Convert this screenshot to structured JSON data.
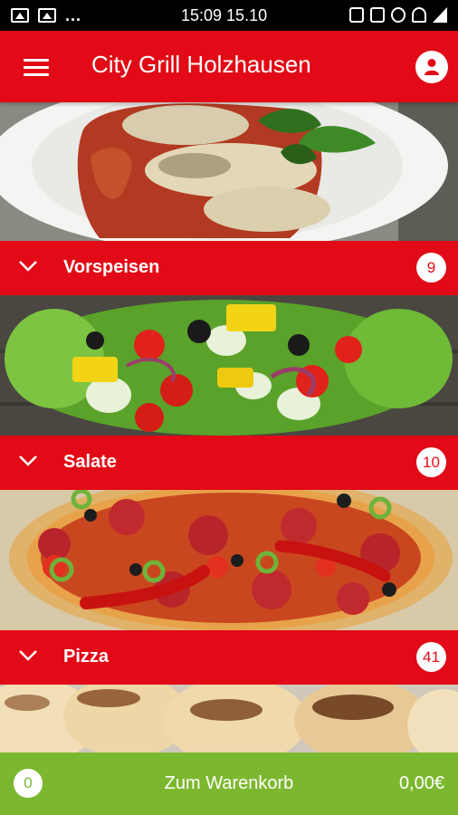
{
  "status_bar": {
    "time": "15:09 15.10",
    "dots": "..."
  },
  "app_bar": {
    "title": "City Grill Holzhausen"
  },
  "categories": [
    {
      "label": "Vorspeisen",
      "count": "9"
    },
    {
      "label": "Salate",
      "count": "10"
    },
    {
      "label": "Pizza",
      "count": "41"
    }
  ],
  "cart": {
    "count": "0",
    "label": "Zum Warenkorb",
    "total": "0,00€"
  },
  "colors": {
    "brand_red": "#e20a16",
    "cart_green": "#7cb82f"
  }
}
